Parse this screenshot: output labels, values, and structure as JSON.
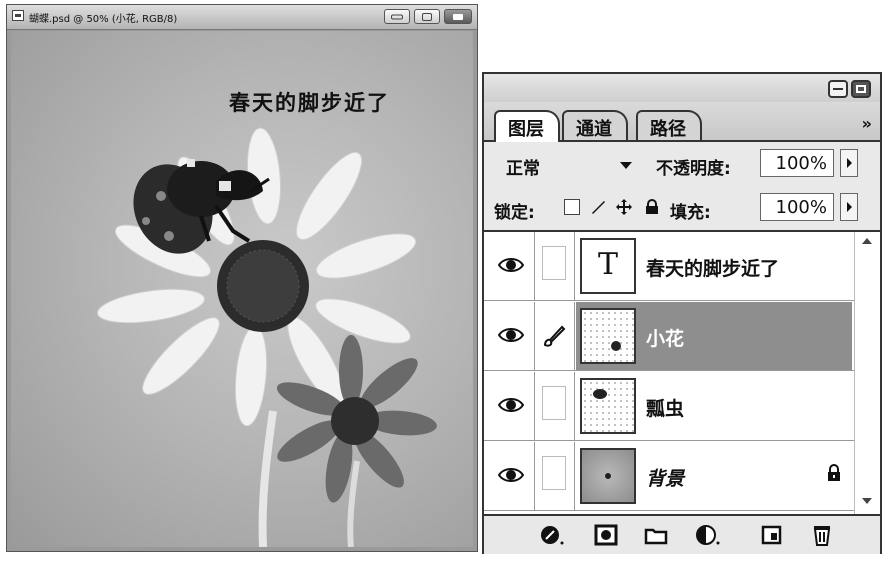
{
  "document": {
    "title": "蝴蝶.psd @ 50% (小花, RGB/8)",
    "canvas_text": "春天的脚步近了"
  },
  "layers_panel": {
    "tabs": [
      {
        "label": "图层",
        "active": true
      },
      {
        "label": "通道",
        "active": false
      },
      {
        "label": "路径",
        "active": false
      }
    ],
    "menu_glyph": "»",
    "blend_mode": "正常",
    "opacity_label": "不透明度:",
    "opacity_value": "100%",
    "lock_label": "锁定:",
    "fill_label": "填充:",
    "fill_value": "100%",
    "layers": [
      {
        "name": "春天的脚步近了",
        "thumb_glyph": "T",
        "selected": false
      },
      {
        "name": "小花",
        "selected": true
      },
      {
        "name": "瓢虫",
        "selected": false
      },
      {
        "name": "背景",
        "selected": false,
        "locked": true
      }
    ]
  },
  "colors": {
    "selected_layer": "#8e8e8e",
    "panel_border": "#333333"
  }
}
